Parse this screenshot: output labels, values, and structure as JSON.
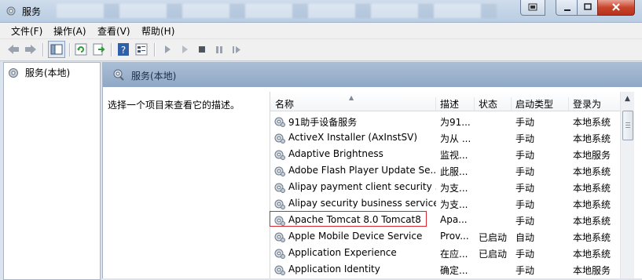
{
  "window": {
    "title": "服务"
  },
  "menu": [
    "文件(F)",
    "操作(A)",
    "查看(V)",
    "帮助(H)"
  ],
  "left_tree": {
    "root": "服务(本地)"
  },
  "right_header": {
    "title": "服务(本地)"
  },
  "description_prompt": "选择一个项目来查看它的描述。",
  "columns": [
    "名称",
    "描述",
    "状态",
    "启动类型",
    "登录为"
  ],
  "services": [
    {
      "name": "91助手设备服务",
      "desc": "为91...",
      "status": "",
      "startup": "手动",
      "logon": "本地系统"
    },
    {
      "name": "ActiveX Installer (AxInstSV)",
      "desc": "为从 ...",
      "status": "",
      "startup": "手动",
      "logon": "本地系统"
    },
    {
      "name": "Adaptive Brightness",
      "desc": "监视...",
      "status": "",
      "startup": "手动",
      "logon": "本地服务"
    },
    {
      "name": "Adobe Flash Player Update Se...",
      "desc": "此服...",
      "status": "",
      "startup": "手动",
      "logon": "本地系统"
    },
    {
      "name": "Alipay payment client security ...",
      "desc": "为支...",
      "status": "",
      "startup": "手动",
      "logon": "本地系统"
    },
    {
      "name": "Alipay security business service",
      "desc": "为支...",
      "status": "",
      "startup": "手动",
      "logon": "本地系统"
    },
    {
      "name": "Apache Tomcat 8.0 Tomcat8",
      "desc": "Apa...",
      "status": "",
      "startup": "手动",
      "logon": "本地系统"
    },
    {
      "name": "Apple Mobile Device Service",
      "desc": "Prov...",
      "status": "已启动",
      "startup": "自动",
      "logon": "本地系统"
    },
    {
      "name": "Application Experience",
      "desc": "在应...",
      "status": "已启动",
      "startup": "手动",
      "logon": "本地系统"
    },
    {
      "name": "Application Identity",
      "desc": "确定...",
      "status": "",
      "startup": "手动",
      "logon": "本地服务"
    }
  ],
  "colors": {
    "highlight_border": "#d9272e",
    "header_band": "#9fb5cf"
  }
}
